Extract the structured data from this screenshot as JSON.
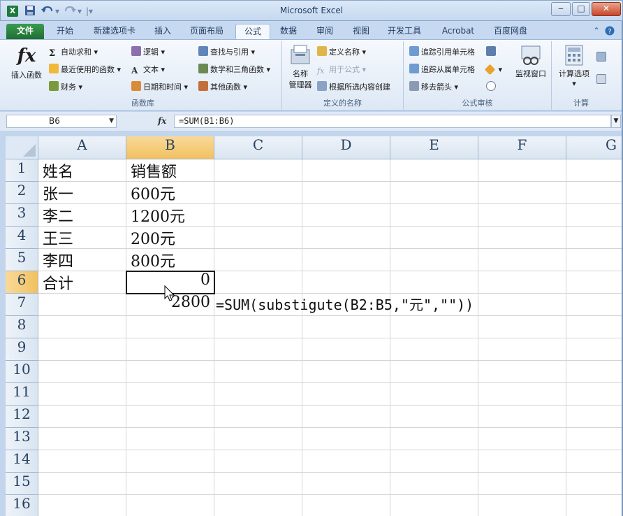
{
  "window": {
    "title": "Microsoft Excel",
    "app_icon": "X",
    "minimize": "‒",
    "maximize": "□",
    "close": "✕"
  },
  "quick_access": {
    "save_icon": "save-icon",
    "undo_icon": "undo-icon",
    "redo_icon": "redo-icon",
    "customize_icon": "customize-icon"
  },
  "tabs": [
    "文件",
    "开始",
    "新建选项卡",
    "插入",
    "页面布局",
    "公式",
    "数据",
    "审阅",
    "视图",
    "开发工具",
    "Acrobat",
    "百度网盘"
  ],
  "active_tab": "公式",
  "ribbon": {
    "insert_function": {
      "symbol": "fx",
      "label": "插入函数"
    },
    "library": {
      "autosum": "自动求和",
      "recent": "最近使用的函数",
      "financial": "财务",
      "logical": "逻辑",
      "text": "文本",
      "datetime": "日期和时间",
      "lookup": "查找与引用",
      "math": "数学和三角函数",
      "other": "其他函数",
      "group_label": "函数库"
    },
    "names": {
      "manager_line1": "名称",
      "manager_line2": "管理器",
      "define": "定义名称",
      "use_in_formula": "用于公式",
      "create_from_selection": "根据所选内容创建",
      "group_label": "定义的名称"
    },
    "audit": {
      "trace_precedents": "追踪引用单元格",
      "trace_dependents": "追踪从属单元格",
      "remove_arrows": "移去箭头",
      "watch_window": "监视窗口",
      "group_label": "公式审核"
    },
    "calc": {
      "options": "计算选项",
      "group_label": "计算"
    }
  },
  "formula_bar": {
    "name_box": "B6",
    "fx": "fx",
    "formula": "=SUM(B1:B6)"
  },
  "grid": {
    "columns": [
      "A",
      "B",
      "C",
      "D",
      "E",
      "F",
      "G"
    ],
    "rows": [
      "1",
      "2",
      "3",
      "4",
      "5",
      "6",
      "7",
      "8",
      "9",
      "10",
      "11",
      "12",
      "13",
      "14",
      "15",
      "16"
    ],
    "cells": {
      "A1": "姓名",
      "B1": "销售额",
      "A2": "张一",
      "B2": "600元",
      "A3": "李二",
      "B3": "1200元",
      "A4": "王三",
      "B4": "200元",
      "A5": "李四",
      "B5": "800元",
      "A6": "合计",
      "B6": "0",
      "B7": "2800",
      "C7": "=SUM(substigute(B2:B5,\"元\",\"\"))"
    },
    "active_cell": "B6"
  },
  "colors": {
    "file_tab": "#1e6e33",
    "selected_header": "#f1c15f",
    "gridline": "#d4d4d4"
  }
}
